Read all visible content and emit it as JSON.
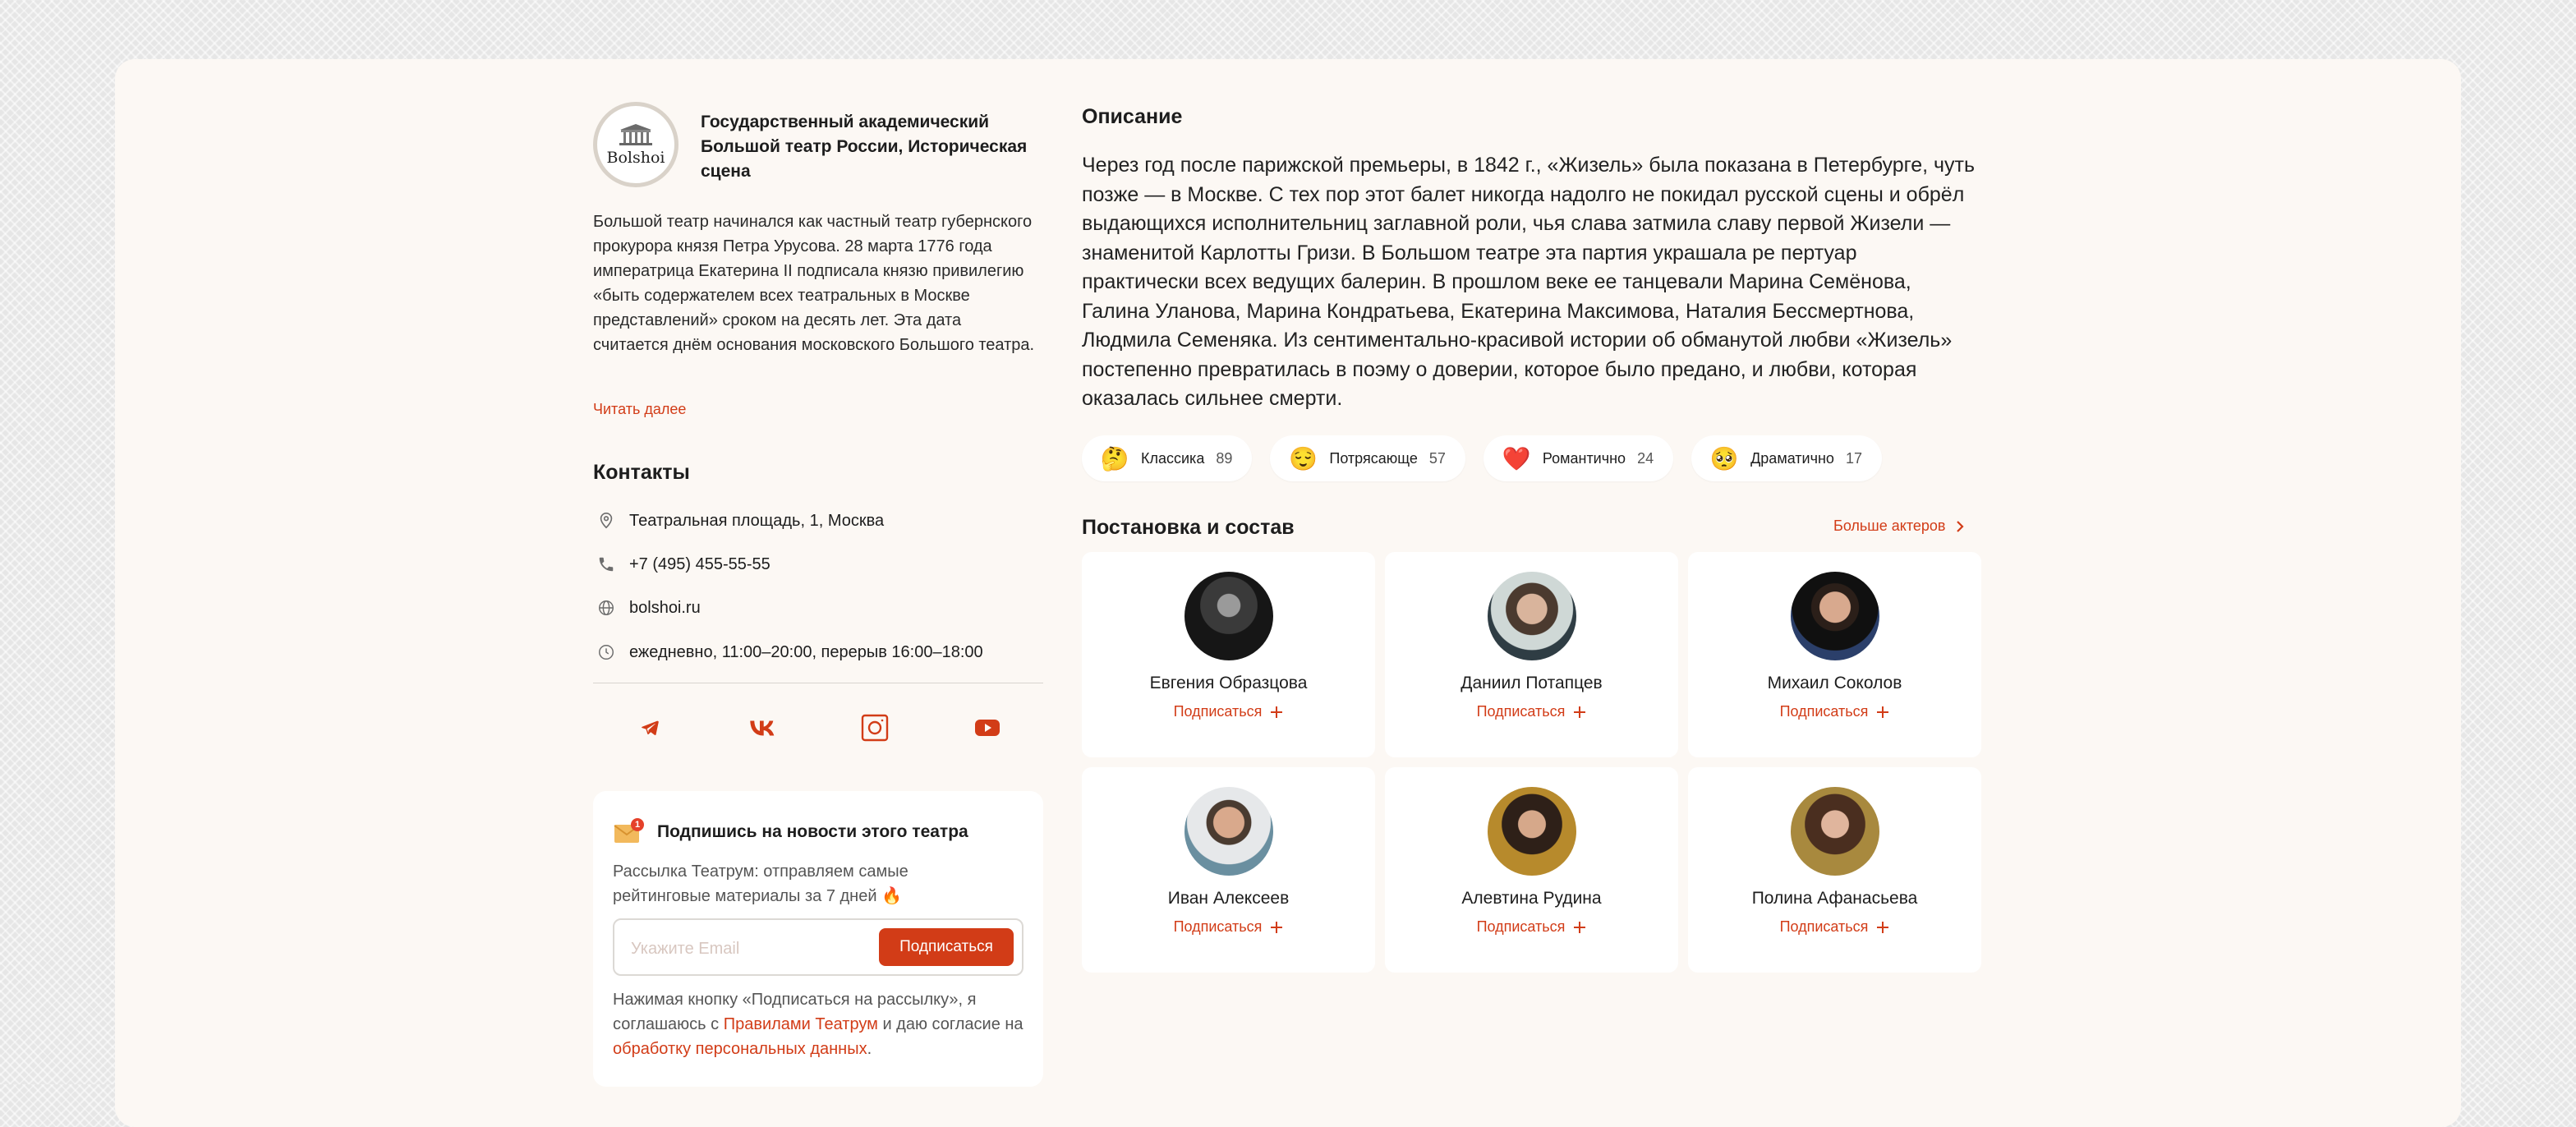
{
  "theatre": {
    "logo_text": "Bolshoi",
    "name": "Государственный академический Большой театр России, Историческая сцена",
    "about": "Большой театр начинался как частный театр губернского прокурора князя Петра Урусова. 28 марта 1776 года императрица Екатерина II подписала князю привилегию «быть содержателем всех театральных в Москве представлений» сроком на десять лет. Эта дата считается днём основания московского Большого театра.",
    "read_more": "Читать далее"
  },
  "contacts": {
    "title": "Контакты",
    "address": "Театральная площадь, 1, Москва",
    "phone": "+7 (495) 455-55-55",
    "site": "bolshoi.ru",
    "hours": "ежедневно, 11:00–20:00, перерыв 16:00–18:00",
    "socials": [
      "telegram-icon",
      "vk-icon",
      "instagram-icon",
      "youtube-icon"
    ]
  },
  "subscribe": {
    "badge": "1",
    "title": "Подпишись на новости этого театра",
    "desc": "Рассылка Театрум: отправляем самые рейтинговые материалы за 7 дней 🔥",
    "placeholder": "Укажите Email",
    "button": "Подписаться",
    "consent_1": "Нажимая кнопку «Подписаться на рассылку», я соглашаюсь с ",
    "consent_link_1": "Правилами Театрум",
    "consent_2": " и даю согласие на ",
    "consent_link_2": "обработку персональных данных",
    "consent_3": "."
  },
  "description": {
    "title": "Описание",
    "text": "Через год после парижской премьеры, в 1842 г., «Жизель» была показана в Петербурге, чуть позже — в Москве. С тех пор этот балет никогда надолго не покидал русской сцены и обрёл выдающихся исполнительниц заглавной роли, чья слава затмила славу первой Жизели — знаменитой Карлотты Гризи. В Большом театре эта партия украшала ре пертуар практически всех ведущих балерин. В прошлом веке ее танцевали Марина Семёнова, Галина Уланова, Марина Кондратьева, Екатерина Максимова, Наталия Бессмертнова, Людмила Семеняка. Из сентиментально-красивой истории об обманутой любви «Жизель» постепенно превратилась в поэму о доверии, которое было предано, и любви, которая оказалась сильнее смерти."
  },
  "reactions": [
    {
      "emoji": "🤔",
      "label": "Классика",
      "count": "89"
    },
    {
      "emoji": "😌",
      "label": "Потрясающе",
      "count": "57"
    },
    {
      "emoji": "❤️",
      "label": "Романтично",
      "count": "24"
    },
    {
      "emoji": "🥺",
      "label": "Драматично",
      "count": "17"
    }
  ],
  "cast": {
    "title": "Постановка и состав",
    "more": "Больше актеров",
    "follow_label": "Подписаться",
    "actors": [
      {
        "name": "Евгения Образцова"
      },
      {
        "name": "Даниил Потапцев"
      },
      {
        "name": "Михаил Соколов"
      },
      {
        "name": "Иван Алексеев"
      },
      {
        "name": "Алевтина Рудина"
      },
      {
        "name": "Полина Афанасьева"
      }
    ]
  },
  "colors": {
    "accent": "#d23c17",
    "card_bg": "#fcf8f4"
  }
}
